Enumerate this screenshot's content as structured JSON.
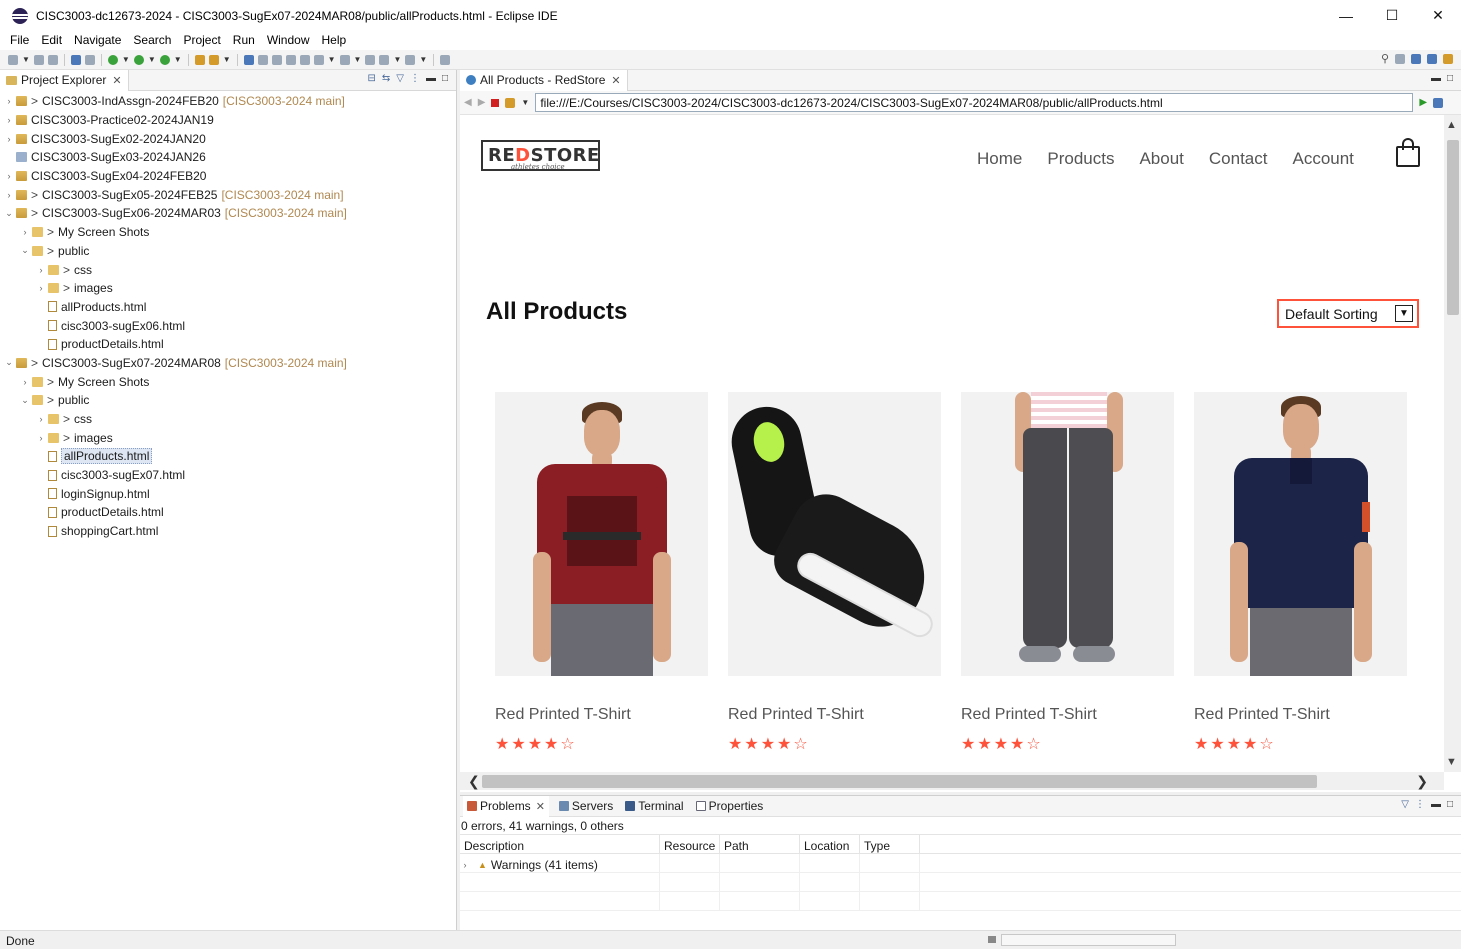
{
  "window": {
    "title": "CISC3003-dc12673-2024 - CISC3003-SugEx07-2024MAR08/public/allProducts.html - Eclipse IDE",
    "controls": [
      "—",
      "☐",
      "✕"
    ]
  },
  "menu": [
    "File",
    "Edit",
    "Navigate",
    "Search",
    "Project",
    "Run",
    "Window",
    "Help"
  ],
  "explorer": {
    "tab_label": "Project Explorer",
    "rows": [
      {
        "indent": 0,
        "twisty": ">",
        "icon": "proj",
        "gt": ">",
        "label": "CISC3003-IndAssgn-2024FEB20",
        "repo": "[CISC3003-2024 main]"
      },
      {
        "indent": 0,
        "twisty": ">",
        "icon": "proj",
        "gt": "",
        "label": "CISC3003-Practice02-2024JAN19",
        "repo": ""
      },
      {
        "indent": 0,
        "twisty": ">",
        "icon": "proj",
        "gt": "",
        "label": "CISC3003-SugEx02-2024JAN20",
        "repo": ""
      },
      {
        "indent": 0,
        "twisty": "",
        "icon": "proj-closed",
        "gt": "",
        "label": "CISC3003-SugEx03-2024JAN26",
        "repo": ""
      },
      {
        "indent": 0,
        "twisty": ">",
        "icon": "proj",
        "gt": "",
        "label": "CISC3003-SugEx04-2024FEB20",
        "repo": ""
      },
      {
        "indent": 0,
        "twisty": ">",
        "icon": "proj",
        "gt": ">",
        "label": "CISC3003-SugEx05-2024FEB25",
        "repo": "[CISC3003-2024 main]"
      },
      {
        "indent": 0,
        "twisty": "v",
        "icon": "proj",
        "gt": ">",
        "label": "CISC3003-SugEx06-2024MAR03",
        "repo": "[CISC3003-2024 main]"
      },
      {
        "indent": 1,
        "twisty": ">",
        "icon": "fold",
        "gt": ">",
        "label": "My Screen Shots",
        "repo": ""
      },
      {
        "indent": 1,
        "twisty": "v",
        "icon": "fold",
        "gt": ">",
        "label": "public",
        "repo": ""
      },
      {
        "indent": 2,
        "twisty": ">",
        "icon": "fold",
        "gt": ">",
        "label": "css",
        "repo": ""
      },
      {
        "indent": 2,
        "twisty": ">",
        "icon": "fold",
        "gt": ">",
        "label": "images",
        "repo": ""
      },
      {
        "indent": 2,
        "twisty": "",
        "icon": "file",
        "gt": "",
        "label": "allProducts.html",
        "repo": ""
      },
      {
        "indent": 2,
        "twisty": "",
        "icon": "file",
        "gt": "",
        "label": "cisc3003-sugEx06.html",
        "repo": ""
      },
      {
        "indent": 2,
        "twisty": "",
        "icon": "file",
        "gt": "",
        "label": "productDetails.html",
        "repo": ""
      },
      {
        "indent": 0,
        "twisty": "v",
        "icon": "proj",
        "gt": ">",
        "label": "CISC3003-SugEx07-2024MAR08",
        "repo": "[CISC3003-2024 main]"
      },
      {
        "indent": 1,
        "twisty": ">",
        "icon": "fold",
        "gt": ">",
        "label": "My Screen Shots",
        "repo": ""
      },
      {
        "indent": 1,
        "twisty": "v",
        "icon": "fold",
        "gt": ">",
        "label": "public",
        "repo": ""
      },
      {
        "indent": 2,
        "twisty": ">",
        "icon": "fold",
        "gt": ">",
        "label": "css",
        "repo": ""
      },
      {
        "indent": 2,
        "twisty": ">",
        "icon": "fold",
        "gt": ">",
        "label": "images",
        "repo": ""
      },
      {
        "indent": 2,
        "twisty": "",
        "icon": "file",
        "gt": "",
        "label": "allProducts.html",
        "repo": "",
        "selected": true
      },
      {
        "indent": 2,
        "twisty": "",
        "icon": "file",
        "gt": "",
        "label": "cisc3003-sugEx07.html",
        "repo": ""
      },
      {
        "indent": 2,
        "twisty": "",
        "icon": "file",
        "gt": "",
        "label": "loginSignup.html",
        "repo": ""
      },
      {
        "indent": 2,
        "twisty": "",
        "icon": "file",
        "gt": "",
        "label": "productDetails.html",
        "repo": ""
      },
      {
        "indent": 2,
        "twisty": "",
        "icon": "file",
        "gt": "",
        "label": "shoppingCart.html",
        "repo": ""
      }
    ]
  },
  "editor": {
    "tab_label": "All Products - RedStore",
    "url": "file:///E:/Courses/CISC3003-2024/CISC3003-dc12673-2024/CISC3003-SugEx07-2024MAR08/public/allProducts.html"
  },
  "site": {
    "logo_main_a": "RE",
    "logo_main_b": "D",
    "logo_main_c": "STORE",
    "logo_sub": "athletes choice",
    "nav": [
      "Home",
      "Products",
      "About",
      "Contact",
      "Account"
    ],
    "page_title": "All Products",
    "sort_label": "Default Sorting",
    "products": [
      {
        "name": "Red Printed T-Shirt",
        "rating": 4,
        "max_rating": 5,
        "image": "red-tshirt"
      },
      {
        "name": "Red Printed T-Shirt",
        "rating": 4,
        "max_rating": 5,
        "image": "black-shoes"
      },
      {
        "name": "Red Printed T-Shirt",
        "rating": 4,
        "max_rating": 5,
        "image": "grey-trousers"
      },
      {
        "name": "Red Printed T-Shirt",
        "rating": 4,
        "max_rating": 5,
        "image": "navy-polo"
      }
    ],
    "accent_color": "#ff523b"
  },
  "bottom_panel": {
    "tabs": [
      "Problems",
      "Servers",
      "Terminal",
      "Properties"
    ],
    "summary": "0 errors, 41 warnings, 0 others",
    "columns": [
      "Description",
      "Resource",
      "Path",
      "Location",
      "Type"
    ],
    "rows": [
      {
        "description": "Warnings (41 items)"
      }
    ]
  },
  "status": {
    "text": "Done"
  }
}
